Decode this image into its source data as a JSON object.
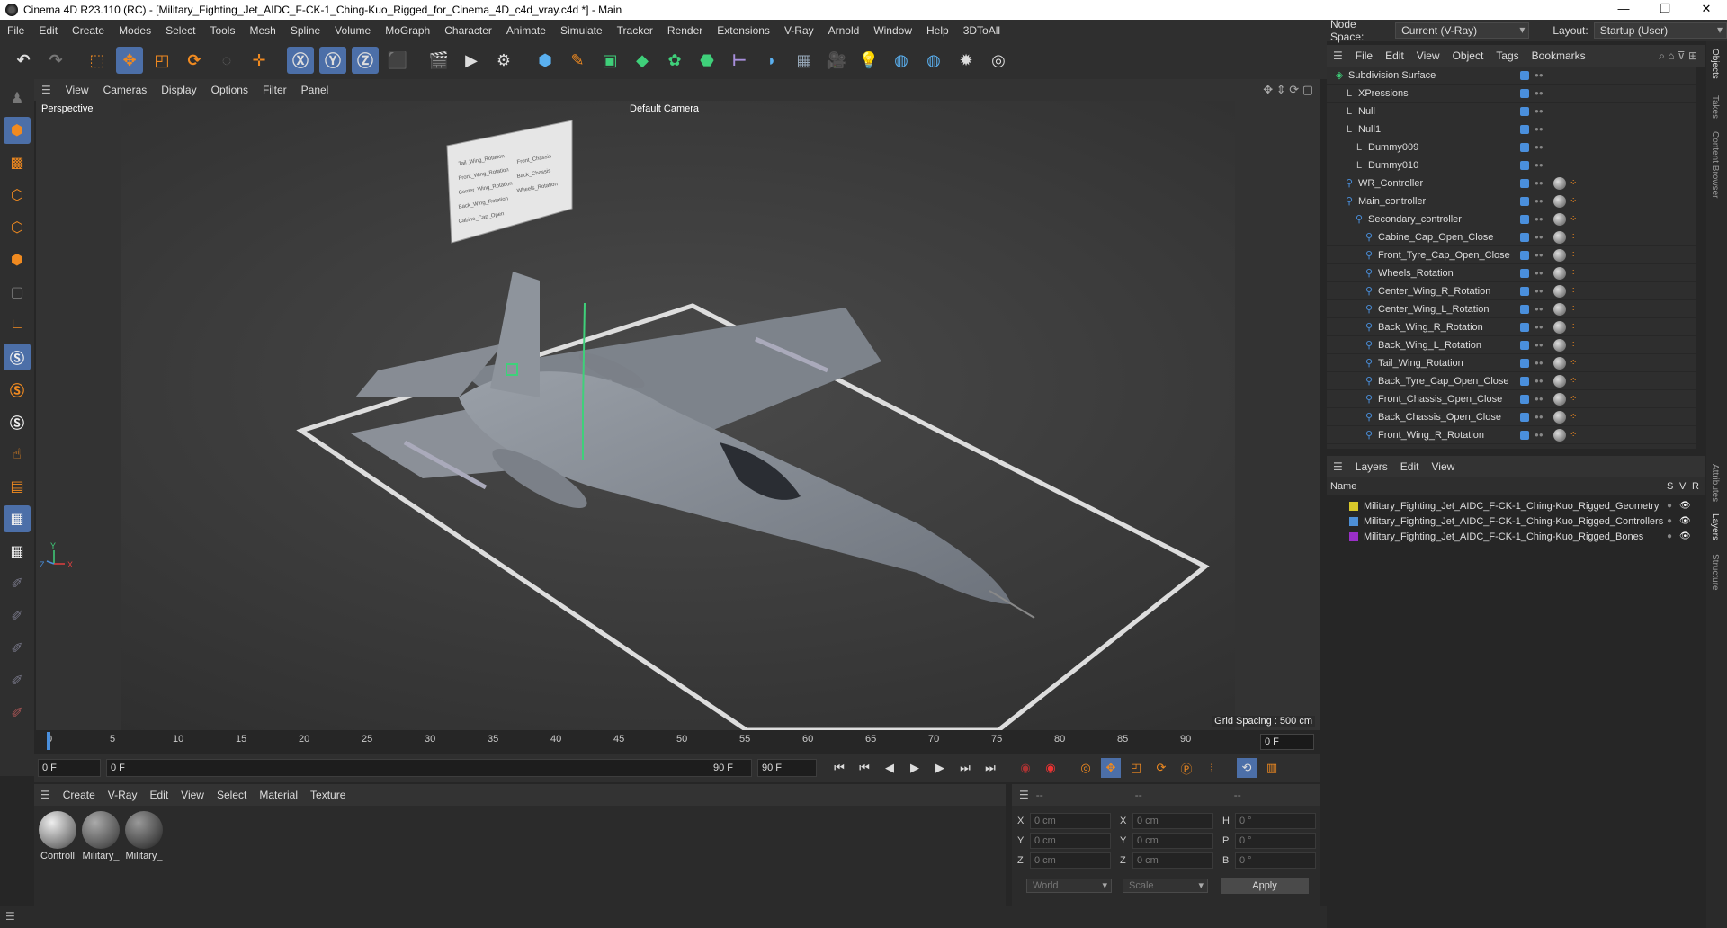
{
  "window": {
    "title": "Cinema 4D R23.110 (RC) - [Military_Fighting_Jet_AIDC_F-CK-1_Ching-Kuo_Rigged_for_Cinema_4D_c4d_vray.c4d *] - Main",
    "minimize": "—",
    "maximize": "❐",
    "close": "✕"
  },
  "menu": [
    "File",
    "Edit",
    "Create",
    "Modes",
    "Select",
    "Tools",
    "Mesh",
    "Spline",
    "Volume",
    "MoGraph",
    "Character",
    "Animate",
    "Simulate",
    "Tracker",
    "Render",
    "Extensions",
    "V-Ray",
    "Arnold",
    "Window",
    "Help",
    "3DToAll"
  ],
  "nodespace": {
    "label": "Node Space:",
    "value": "Current (V-Ray)",
    "layout_label": "Layout:",
    "layout_value": "Startup (User)"
  },
  "viewport": {
    "menu": [
      "View",
      "Cameras",
      "Display",
      "Options",
      "Filter",
      "Panel"
    ],
    "label": "Perspective",
    "camera": "Default Camera",
    "grid_spacing": "Grid Spacing : 500 cm",
    "axis_x": "X",
    "axis_y": "Y",
    "axis_z": "Z",
    "panel_lines": [
      "Tail_Wing_Rotation",
      "Front_Wing_Rotation",
      "Center_Wing_Rotation",
      "Back_Wing_Rotation",
      "Cabine_Cap_Open",
      "Front_Chassis",
      "Back_Chassis",
      "Wheels_Rotation"
    ]
  },
  "timeline": {
    "ticks": [
      "0",
      "5",
      "10",
      "15",
      "20",
      "25",
      "30",
      "35",
      "40",
      "45",
      "50",
      "55",
      "60",
      "65",
      "70",
      "75",
      "80",
      "85",
      "90"
    ],
    "current_frame": "0 F"
  },
  "transport": {
    "start": "0 F",
    "range_start": "0 F",
    "range_end": "90 F",
    "end": "90 F"
  },
  "materials": {
    "menu": [
      "Create",
      "V-Ray",
      "Edit",
      "View",
      "Select",
      "Material",
      "Texture"
    ],
    "items": [
      "Controll",
      "Military_",
      "Military_"
    ]
  },
  "coords": {
    "header": [
      "--",
      "--",
      "--"
    ],
    "rows": [
      {
        "a": "X",
        "av": "0 cm",
        "b": "X",
        "bv": "0 cm",
        "c": "H",
        "cv": "0 °"
      },
      {
        "a": "Y",
        "av": "0 cm",
        "b": "Y",
        "bv": "0 cm",
        "c": "P",
        "cv": "0 °"
      },
      {
        "a": "Z",
        "av": "0 cm",
        "b": "Z",
        "bv": "0 cm",
        "c": "B",
        "cv": "0 °"
      }
    ],
    "world": "World",
    "scale": "Scale",
    "apply": "Apply"
  },
  "objects": {
    "menu": [
      "File",
      "Edit",
      "View",
      "Object",
      "Tags",
      "Bookmarks"
    ],
    "items": [
      {
        "name": "Subdivision Surface",
        "indent": 0
      },
      {
        "name": "XPressions",
        "indent": 1
      },
      {
        "name": "Null",
        "indent": 1
      },
      {
        "name": "Null1",
        "indent": 1
      },
      {
        "name": "Dummy009",
        "indent": 2
      },
      {
        "name": "Dummy010",
        "indent": 2
      },
      {
        "name": "WR_Controller",
        "indent": 1
      },
      {
        "name": "Main_controller",
        "indent": 1
      },
      {
        "name": "Secondary_controller",
        "indent": 2
      },
      {
        "name": "Cabine_Cap_Open_Close",
        "indent": 3
      },
      {
        "name": "Front_Tyre_Cap_Open_Close",
        "indent": 3
      },
      {
        "name": "Wheels_Rotation",
        "indent": 3
      },
      {
        "name": "Center_Wing_R_Rotation",
        "indent": 3
      },
      {
        "name": "Center_Wing_L_Rotation",
        "indent": 3
      },
      {
        "name": "Back_Wing_R_Rotation",
        "indent": 3
      },
      {
        "name": "Back_Wing_L_Rotation",
        "indent": 3
      },
      {
        "name": "Tail_Wing_Rotation",
        "indent": 3
      },
      {
        "name": "Back_Tyre_Cap_Open_Close",
        "indent": 3
      },
      {
        "name": "Front_Chassis_Open_Close",
        "indent": 3
      },
      {
        "name": "Back_Chassis_Open_Close",
        "indent": 3
      },
      {
        "name": "Front_Wing_R_Rotation",
        "indent": 3
      }
    ]
  },
  "layers": {
    "menu": [
      "Layers",
      "Edit",
      "View"
    ],
    "col_name": "Name",
    "col_s": "S",
    "col_v": "V",
    "col_r": "R",
    "items": [
      {
        "name": "Military_Fighting_Jet_AIDC_F-CK-1_Ching-Kuo_Rigged_Geometry",
        "color": "#d8c82a"
      },
      {
        "name": "Military_Fighting_Jet_AIDC_F-CK-1_Ching-Kuo_Rigged_Controllers",
        "color": "#4d8fd6"
      },
      {
        "name": "Military_Fighting_Jet_AIDC_F-CK-1_Ching-Kuo_Rigged_Bones",
        "color": "#9a2fc8"
      }
    ]
  },
  "side_tabs": [
    "Objects",
    "Takes",
    "Content Browser",
    "Attributes",
    "Layers",
    "Structure"
  ]
}
